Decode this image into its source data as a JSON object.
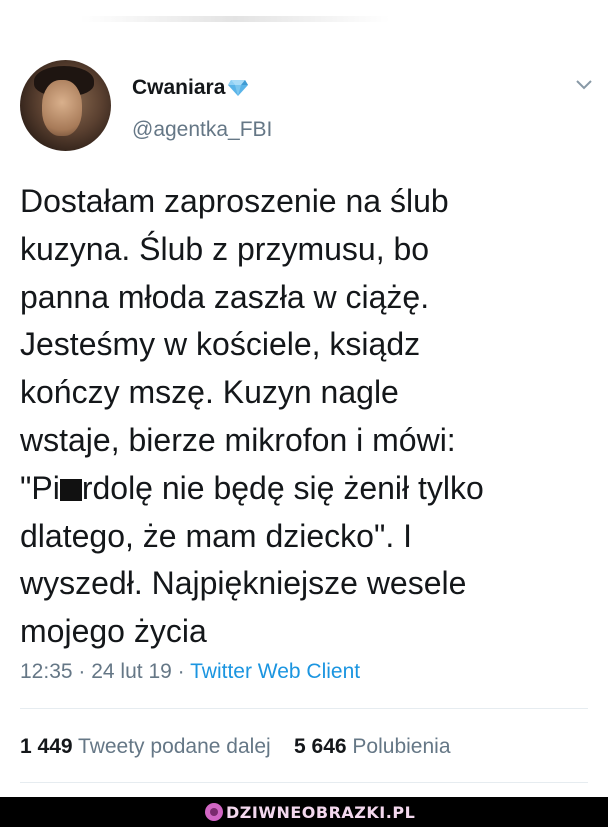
{
  "author": {
    "display_name": "Cwaniara",
    "badge_icon": "gem-icon",
    "handle": "@agentka_FBI",
    "avatar_icon": "avatar"
  },
  "tweet": {
    "text_before_censor": "Dostałam zaproszenie na ślub\nkuzyna. Ślub z przymusu, bo\npanna młoda zaszła w ciążę.\nJesteśmy w kościele, ksiądz\nkończy mszę. Kuzyn nagle\nwstaje, bierze mikrofon i mówi:\n\"Pi",
    "text_after_censor": "rdolę nie będę się żenił tylko\ndlatego, że mam dziecko\". I\nwyszedł. Najpiękniejsze wesele\nmojego życia"
  },
  "meta": {
    "time": "12:35",
    "separator1": " · ",
    "date": "24 lut 19",
    "separator2": " · ",
    "source": "Twitter Web Client"
  },
  "stats": {
    "retweets_count": "1 449",
    "retweets_label": "Tweety podane dalej",
    "likes_count": "5 646",
    "likes_label": "Polubienia"
  },
  "watermark": {
    "text": "DZIWNEOBRAZKI.PL"
  },
  "colors": {
    "text_primary": "#14171a",
    "text_secondary": "#657786",
    "link": "#1b95e0",
    "gem": "#5ab4e8",
    "footer_bg": "#000000"
  }
}
